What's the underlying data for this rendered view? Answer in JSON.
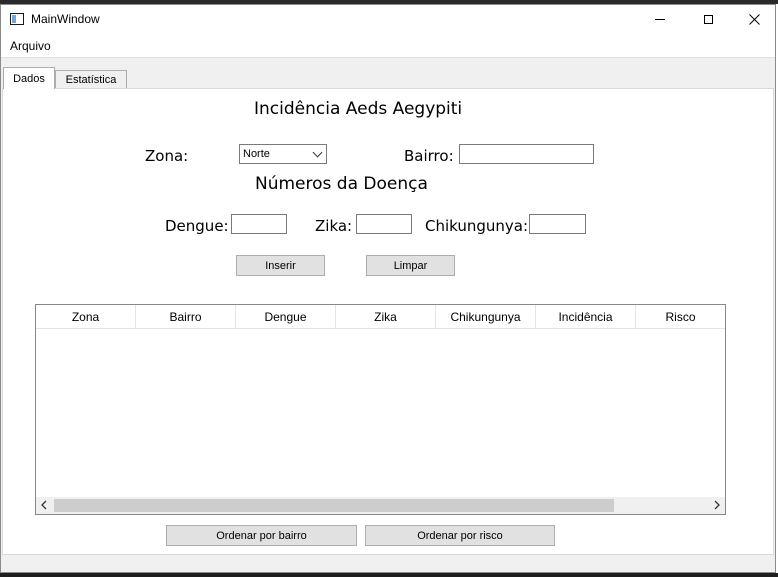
{
  "window": {
    "title": "MainWindow",
    "menu": [
      "Arquivo"
    ]
  },
  "tabs": [
    {
      "label": "Dados",
      "active": true
    },
    {
      "label": "Estatística",
      "active": false
    }
  ],
  "form": {
    "title": "Incidência Aeds Aegypiti",
    "zona_label": "Zona:",
    "zona_value": "Norte",
    "bairro_label": "Bairro:",
    "bairro_value": "",
    "doenca_title": "Números da Doença",
    "dengue_label": "Dengue:",
    "dengue_value": "",
    "zika_label": "Zika:",
    "zika_value": "",
    "chik_label": "Chikungunya:",
    "chik_value": "",
    "inserir_label": "Inserir",
    "limpar_label": "Limpar"
  },
  "table": {
    "columns": [
      "Zona",
      "Bairro",
      "Dengue",
      "Zika",
      "Chikungunya",
      "Incidência",
      "Risco"
    ],
    "rows": []
  },
  "footer": {
    "sort_bairro_label": "Ordenar por bairro",
    "sort_risco_label": "Ordenar por risco"
  },
  "icons": {
    "app": "window-icon",
    "minimize": "minimize-icon",
    "maximize": "maximize-icon",
    "close": "close-icon",
    "dropdown": "chevron-down-icon",
    "scroll_left": "chevron-left-icon",
    "scroll_right": "chevron-right-icon"
  }
}
